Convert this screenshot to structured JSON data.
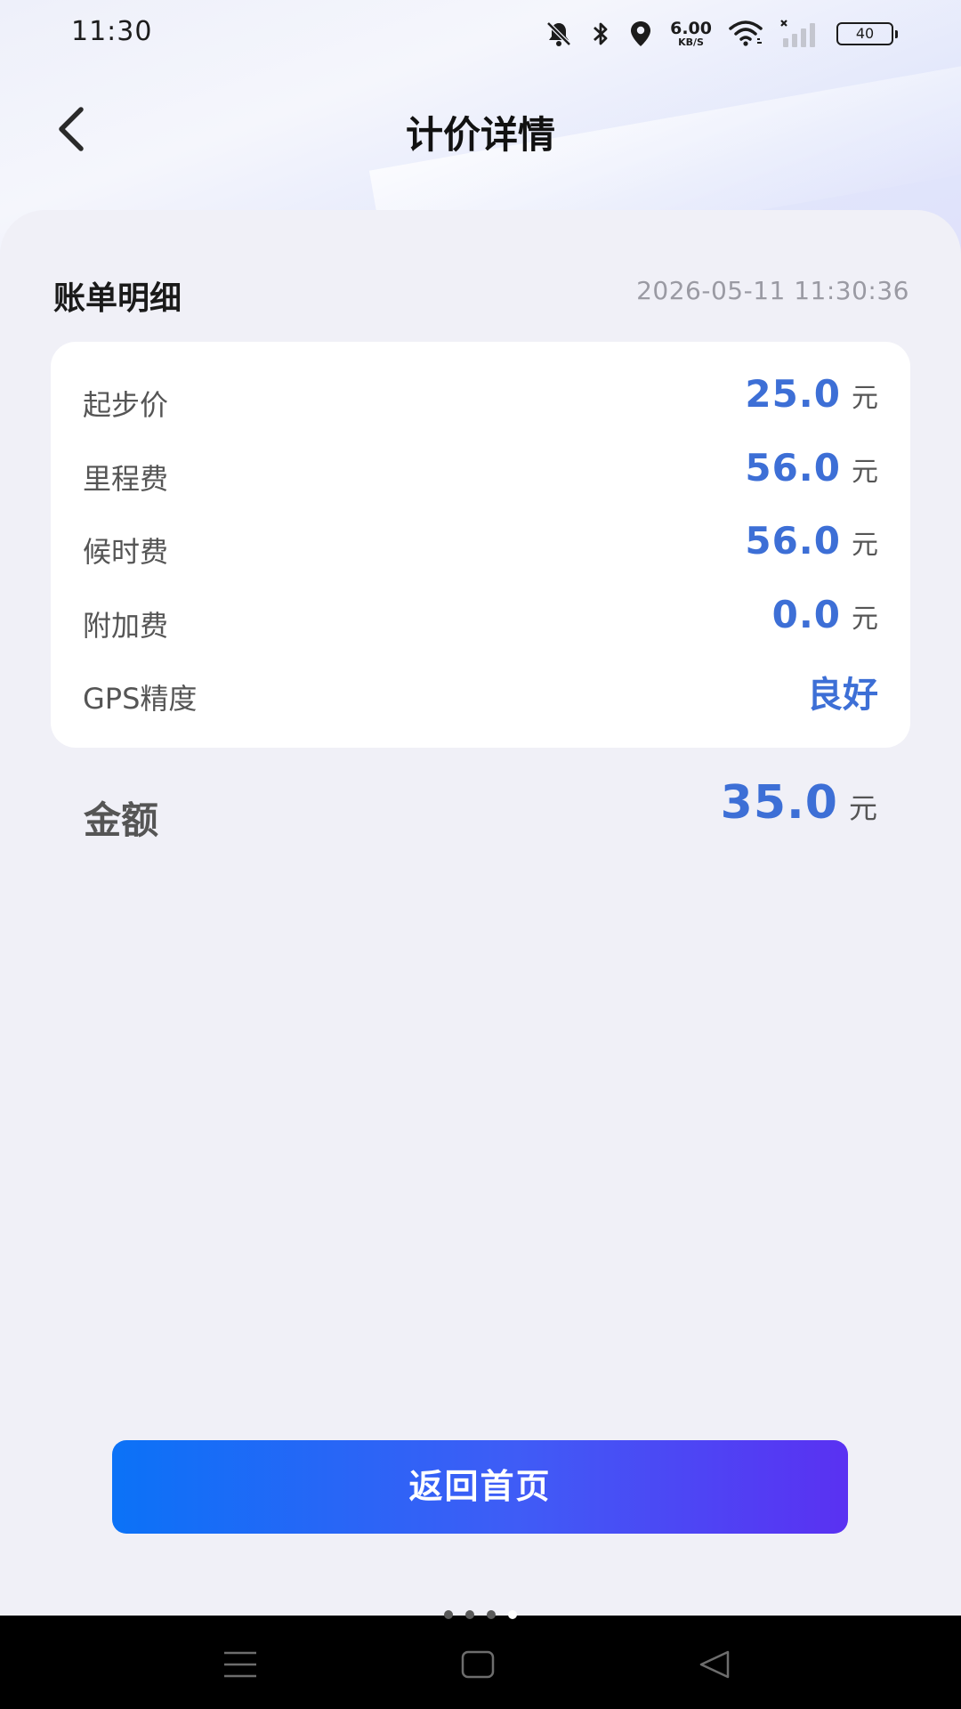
{
  "status_bar": {
    "time": "11:30",
    "net_speed_value": "6.00",
    "net_speed_unit": "KB/S",
    "battery": "40",
    "icons": [
      "mute-bell-icon",
      "bluetooth-icon",
      "location-icon",
      "wifi-icon",
      "signal-icon",
      "battery-icon"
    ]
  },
  "header": {
    "title": "计价详情",
    "back_icon": "chevron-left-icon"
  },
  "bill": {
    "title": "账单明细",
    "timestamp": "2026-05-11 11:30:36",
    "items": [
      {
        "label": "起步价",
        "value": "25.0",
        "unit": "元"
      },
      {
        "label": "里程费",
        "value": "56.0",
        "unit": "元"
      },
      {
        "label": "候时费",
        "value": "56.0",
        "unit": "元"
      },
      {
        "label": "附加费",
        "value": "0.0",
        "unit": "元"
      }
    ],
    "gps": {
      "label": "GPS精度",
      "value": "良好"
    },
    "total": {
      "label": "金额",
      "value": "35.0",
      "unit": "元"
    }
  },
  "actions": {
    "home_button": "返回首页"
  },
  "colors": {
    "accent": "#3d6fd6",
    "button_start": "#0b72f7",
    "button_end": "#5a31f2",
    "background": "#f0f0f7"
  },
  "nav_bar": {
    "icons": [
      "menu-icon",
      "home-icon",
      "back-triangle-icon"
    ]
  }
}
